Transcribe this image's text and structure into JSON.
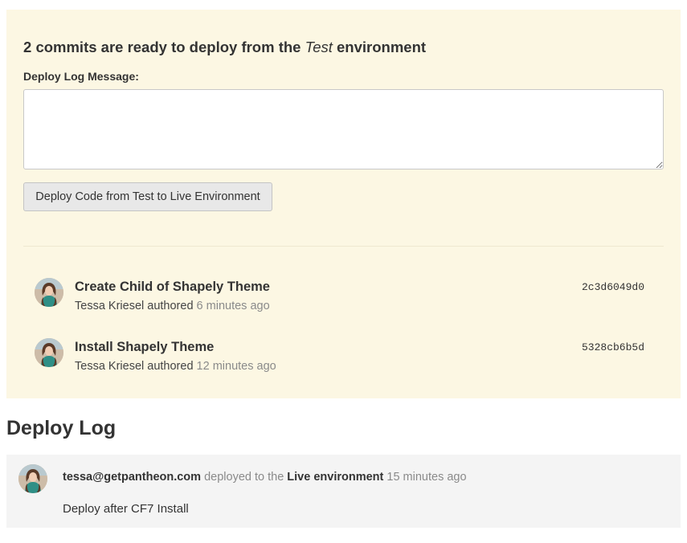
{
  "deploy_panel": {
    "commit_count": "2",
    "heading_prefix": "commits are ready to deploy from the",
    "source_env": "Test",
    "heading_suffix": "environment",
    "message_label": "Deploy Log Message:",
    "message_value": "",
    "button_label": "Deploy Code from Test to Live Environment"
  },
  "commits": [
    {
      "title": "Create Child of Shapely Theme",
      "author": "Tessa Kriesel",
      "action": "authored",
      "time": "6 minutes ago",
      "hash": "2c3d6049d0",
      "avatar_icon": "user-avatar-icon"
    },
    {
      "title": "Install Shapely Theme",
      "author": "Tessa Kriesel",
      "action": "authored",
      "time": "12 minutes ago",
      "hash": "5328cb6b5d",
      "avatar_icon": "user-avatar-icon"
    }
  ],
  "deploy_log": {
    "heading": "Deploy Log",
    "entries": [
      {
        "user": "tessa@getpantheon.com",
        "action": "deployed to the",
        "environment": "Live environment",
        "time": "15 minutes ago",
        "message": "Deploy after CF7 Install",
        "avatar_icon": "user-avatar-icon"
      }
    ]
  },
  "colors": {
    "panel_background": "#fcf7e3",
    "log_background": "#f4f4f4",
    "button_background": "#e8e8e8",
    "muted_text": "#8a8a8a"
  }
}
